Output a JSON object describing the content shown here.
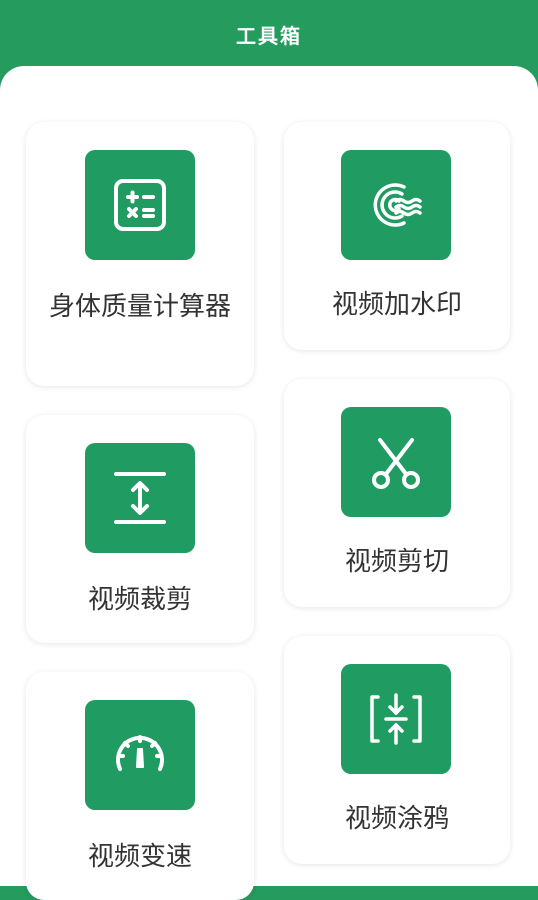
{
  "header": {
    "title": "工具箱"
  },
  "tools": [
    {
      "label": "身体质量计算器",
      "icon": "calculator-icon"
    },
    {
      "label": "视频加水印",
      "icon": "watermark-icon"
    },
    {
      "label": "视频裁剪",
      "icon": "crop-height-icon"
    },
    {
      "label": "视频剪切",
      "icon": "scissors-icon"
    },
    {
      "label": "视频变速",
      "icon": "speedometer-icon"
    },
    {
      "label": "视频涂鸦",
      "icon": "compress-frame-icon"
    }
  ],
  "colors": {
    "brand_green": "#259b5e",
    "tile_green": "#209b62",
    "label_text": "#333333"
  }
}
